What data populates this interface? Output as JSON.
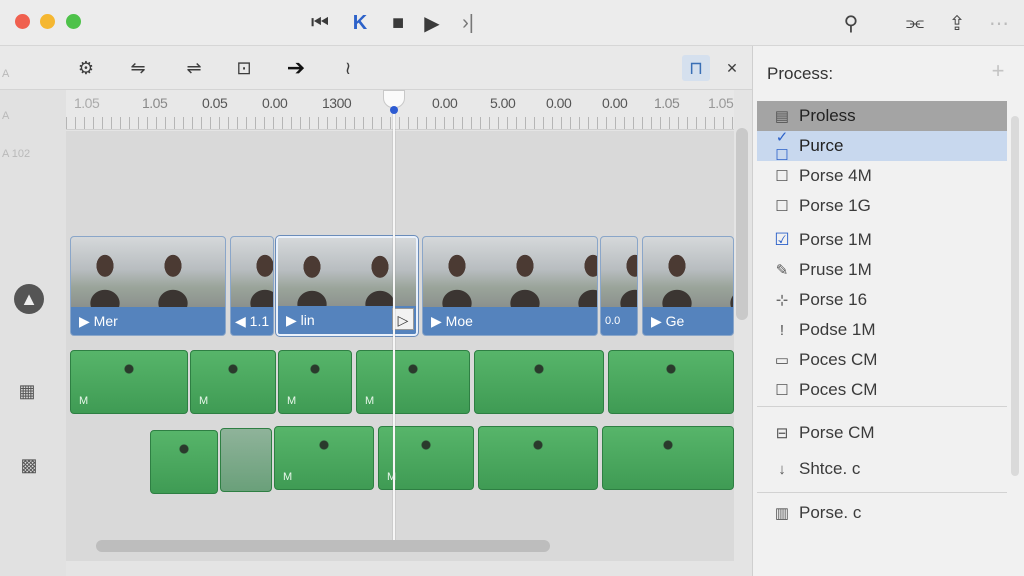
{
  "transport": {
    "skip_back": "⏮",
    "prev": "K",
    "stop": "■",
    "play": "▶",
    "next": "›|"
  },
  "toolbar_right": [
    "⚲",
    "⫘",
    "⇪",
    "⋯"
  ],
  "tools": [
    "⚙",
    "⇋",
    "⇌",
    "⊡",
    "➔",
    "≀"
  ],
  "ruler": {
    "labels": [
      "1.05",
      "1.05",
      "0.05",
      "0.00",
      "1300",
      "0.00",
      "5.00",
      "0.00",
      "0.00",
      "1.05",
      "1.05"
    ]
  },
  "video_clips": [
    {
      "label": "Mer"
    },
    {
      "label": "1.1"
    },
    {
      "label": "lin"
    },
    {
      "label": "Moe"
    },
    {
      "label": "0.0"
    },
    {
      "label": "Ge"
    }
  ],
  "audio_labels": [
    "M",
    "M",
    "M",
    "M",
    "M",
    "M"
  ],
  "panel": {
    "title": "Process:",
    "plus": "+",
    "items": [
      {
        "icon": "▤",
        "label": "Proless"
      },
      {
        "icon": "✓ ☐",
        "label": "Purce"
      },
      {
        "icon": "☐",
        "label": "Porse 4M"
      },
      {
        "icon": "☐",
        "label": "Porse 1G"
      },
      {
        "icon": "☑",
        "label": "Porse 1M"
      },
      {
        "icon": "✎",
        "label": "Pruse 1M"
      },
      {
        "icon": "⊹",
        "label": "Porse 16"
      },
      {
        "icon": "!",
        "label": "Podse 1M"
      },
      {
        "icon": "▭",
        "label": "Poces CM"
      },
      {
        "icon": "☐",
        "label": "Poces CM"
      },
      {
        "icon": "⊟",
        "label": "Porse CM"
      },
      {
        "icon": "↓",
        "label": "Shtce. c"
      },
      {
        "icon": "▥",
        "label": "Porse. c"
      }
    ]
  },
  "gutter_labels": [
    "A",
    "A",
    "A 102"
  ]
}
